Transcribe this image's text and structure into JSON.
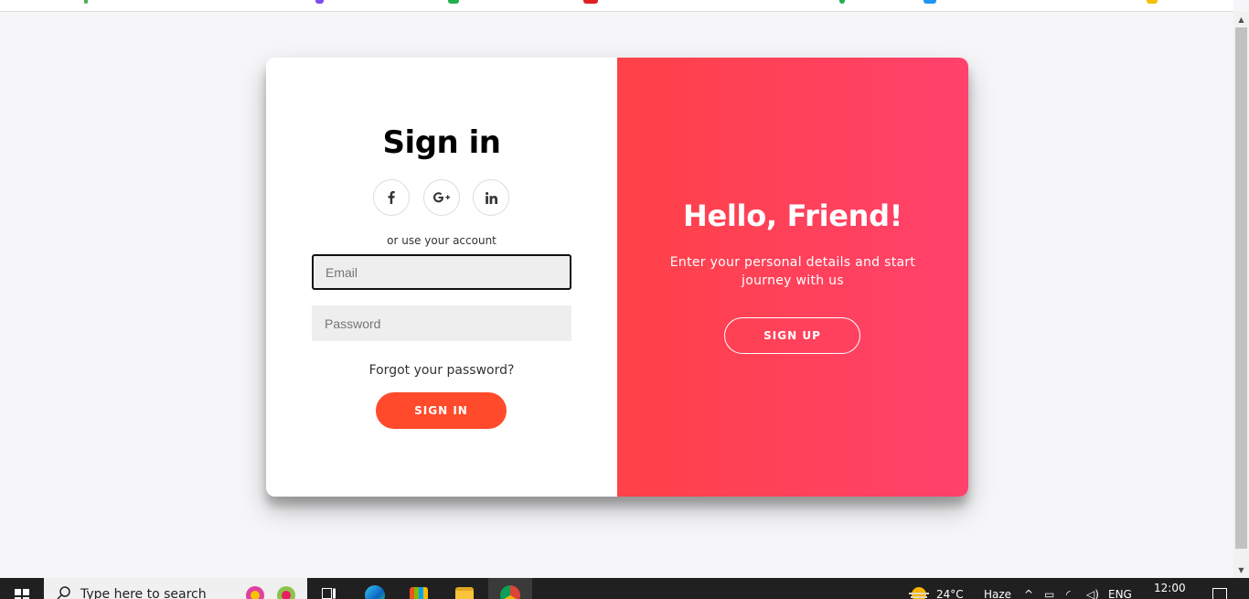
{
  "signin": {
    "title": "Sign in",
    "social": [
      {
        "label": "f",
        "icon": "facebook-icon"
      },
      {
        "label": "G+",
        "icon": "google-plus-icon"
      },
      {
        "label": "in",
        "icon": "linkedin-icon"
      }
    ],
    "subtitle": "or use your account",
    "email_placeholder": "Email",
    "password_placeholder": "Password",
    "forgot": "Forgot your password?",
    "button": "SIGN IN"
  },
  "overlay": {
    "title": "Hello, Friend!",
    "text": "Enter your personal details and start journey with us",
    "button": "SIGN UP"
  },
  "colors": {
    "accent": "#ff4b2b",
    "gradient_start": "#ff4148",
    "gradient_end": "#ff416c",
    "page_bg": "#f6f5f7"
  },
  "taskbar": {
    "search_placeholder": "Type here to search",
    "weather_temp": "24°C",
    "weather_desc": "Haze",
    "language": "ENG",
    "time": "12:00",
    "apps": [
      "task-view-icon",
      "edge-icon",
      "store-icon",
      "file-explorer-icon",
      "chrome-icon"
    ]
  }
}
